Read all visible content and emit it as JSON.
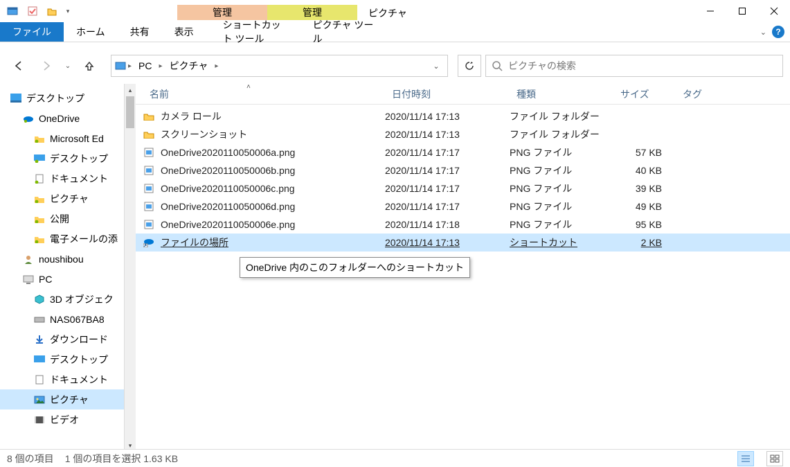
{
  "window": {
    "title": "ピクチャ"
  },
  "context_tabs": {
    "group1": "管理",
    "group2": "管理",
    "tool1": "ショートカット ツール",
    "tool2": "ピクチャ ツール"
  },
  "ribbon": {
    "file": "ファイル",
    "home": "ホーム",
    "share": "共有",
    "view": "表示"
  },
  "breadcrumbs": {
    "pc": "PC",
    "folder": "ピクチャ"
  },
  "search": {
    "placeholder": "ピクチャの検索"
  },
  "columns": {
    "name": "名前",
    "date": "日付時刻",
    "type": "種類",
    "size": "サイズ",
    "tag": "タグ"
  },
  "navtree": {
    "desktop": "デスクトップ",
    "onedrive": "OneDrive",
    "ms_edge": "Microsoft Ed",
    "od_desktop": "デスクトップ",
    "od_documents": "ドキュメント",
    "od_pictures": "ピクチャ",
    "od_public": "公開",
    "od_email": "電子メールの添",
    "noushibou": "noushibou",
    "pc": "PC",
    "pc_3d": "3D オブジェク",
    "pc_nas": "NAS067BA8",
    "pc_downloads": "ダウンロード",
    "pc_desktop": "デスクトップ",
    "pc_documents": "ドキュメント",
    "pc_pictures": "ピクチャ",
    "pc_videos": "ビデオ"
  },
  "files": [
    {
      "name": "カメラ ロール",
      "date": "2020/11/14 17:13",
      "type": "ファイル フォルダー",
      "size": ""
    },
    {
      "name": "スクリーンショット",
      "date": "2020/11/14 17:13",
      "type": "ファイル フォルダー",
      "size": ""
    },
    {
      "name": "OneDrive2020110050006a.png",
      "date": "2020/11/14 17:17",
      "type": "PNG ファイル",
      "size": "57 KB"
    },
    {
      "name": "OneDrive2020110050006b.png",
      "date": "2020/11/14 17:17",
      "type": "PNG ファイル",
      "size": "40 KB"
    },
    {
      "name": "OneDrive2020110050006c.png",
      "date": "2020/11/14 17:17",
      "type": "PNG ファイル",
      "size": "39 KB"
    },
    {
      "name": "OneDrive2020110050006d.png",
      "date": "2020/11/14 17:17",
      "type": "PNG ファイル",
      "size": "49 KB"
    },
    {
      "name": "OneDrive2020110050006e.png",
      "date": "2020/11/14 17:18",
      "type": "PNG ファイル",
      "size": "95 KB"
    },
    {
      "name": "ファイルの場所",
      "date": "2020/11/14 17:13",
      "type": "ショートカット",
      "size": "2 KB"
    }
  ],
  "tooltip": "OneDrive 内のこのフォルダーへのショートカット",
  "status": {
    "items": "8 個の項目",
    "selected": "1 個の項目を選択 1.63 KB"
  }
}
